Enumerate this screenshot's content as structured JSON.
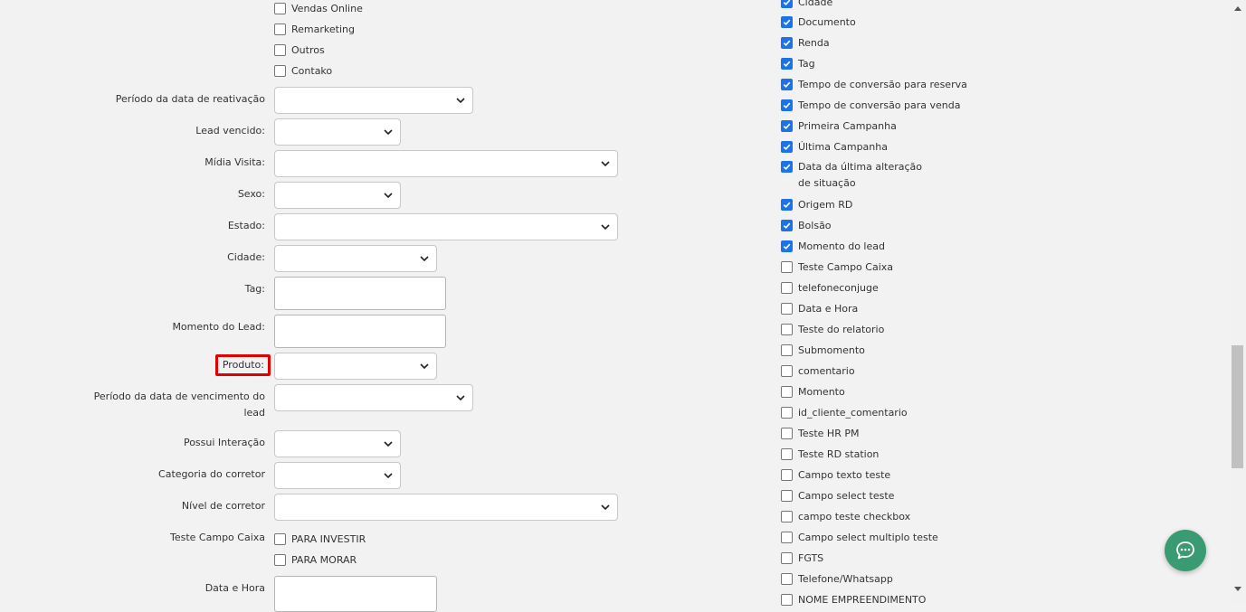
{
  "left_top_checkboxes": [
    {
      "label": "Vendas Online",
      "checked": false
    },
    {
      "label": "Remarketing",
      "checked": false
    },
    {
      "label": "Outros",
      "checked": false
    },
    {
      "label": "Contako",
      "checked": false
    }
  ],
  "fields": {
    "periodo_reativacao": "Período da data de reativação",
    "lead_vencido": "Lead vencido:",
    "midia_visita": "Mídia Visita:",
    "sexo": "Sexo:",
    "estado": "Estado:",
    "cidade": "Cidade:",
    "tag": "Tag:",
    "momento_lead": "Momento do Lead:",
    "produto": "Produto:",
    "periodo_vencimento": "Período da data de vencimento do lead",
    "possui_interacao": "Possui Interação",
    "categoria_corretor": "Categoria do corretor",
    "nivel_corretor": "Nível de corretor",
    "teste_campo_caixa": "Teste Campo Caixa",
    "data_hora": "Data e Hora"
  },
  "teste_campo_caixa_options": [
    {
      "label": "PARA INVESTIR",
      "checked": false
    },
    {
      "label": "PARA MORAR",
      "checked": false
    }
  ],
  "right_columns": [
    {
      "label": "Cidade",
      "checked": true
    },
    {
      "label": "Documento",
      "checked": true
    },
    {
      "label": "Renda",
      "checked": true
    },
    {
      "label": "Tag",
      "checked": true
    },
    {
      "label": "Tempo de conversão para reserva",
      "checked": true
    },
    {
      "label": "Tempo de conversão para venda",
      "checked": true
    },
    {
      "label": "Primeira Campanha",
      "checked": true
    },
    {
      "label": "Última Campanha",
      "checked": true
    },
    {
      "label": "Data da última alteração de situação",
      "checked": true
    },
    {
      "label": "Origem RD",
      "checked": true
    },
    {
      "label": "Bolsão",
      "checked": true
    },
    {
      "label": "Momento do lead",
      "checked": true
    },
    {
      "label": "Teste Campo Caixa",
      "checked": false
    },
    {
      "label": "telefoneconjuge",
      "checked": false
    },
    {
      "label": "Data e Hora",
      "checked": false
    },
    {
      "label": "Teste do relatorio",
      "checked": false
    },
    {
      "label": "Submomento",
      "checked": false
    },
    {
      "label": "comentario",
      "checked": false
    },
    {
      "label": "Momento",
      "checked": false
    },
    {
      "label": "id_cliente_comentario",
      "checked": false
    },
    {
      "label": "Teste HR PM",
      "checked": false
    },
    {
      "label": "Teste RD station",
      "checked": false
    },
    {
      "label": "Campo texto teste",
      "checked": false
    },
    {
      "label": "Campo select teste",
      "checked": false
    },
    {
      "label": "campo teste checkbox",
      "checked": false
    },
    {
      "label": "Campo select multiplo teste",
      "checked": false
    },
    {
      "label": "FGTS",
      "checked": false
    },
    {
      "label": "Telefone/Whatsapp",
      "checked": false
    },
    {
      "label": "NOME EMPREENDIMENTO",
      "checked": false
    }
  ],
  "icons": {
    "chevron": "chevron-down-icon",
    "chat": "chat-bubble-icon",
    "check": "check-icon"
  },
  "colors": {
    "checkbox_checked": "#1a73e8",
    "highlight_border": "#e00000",
    "chat_button": "#3a9b71"
  }
}
